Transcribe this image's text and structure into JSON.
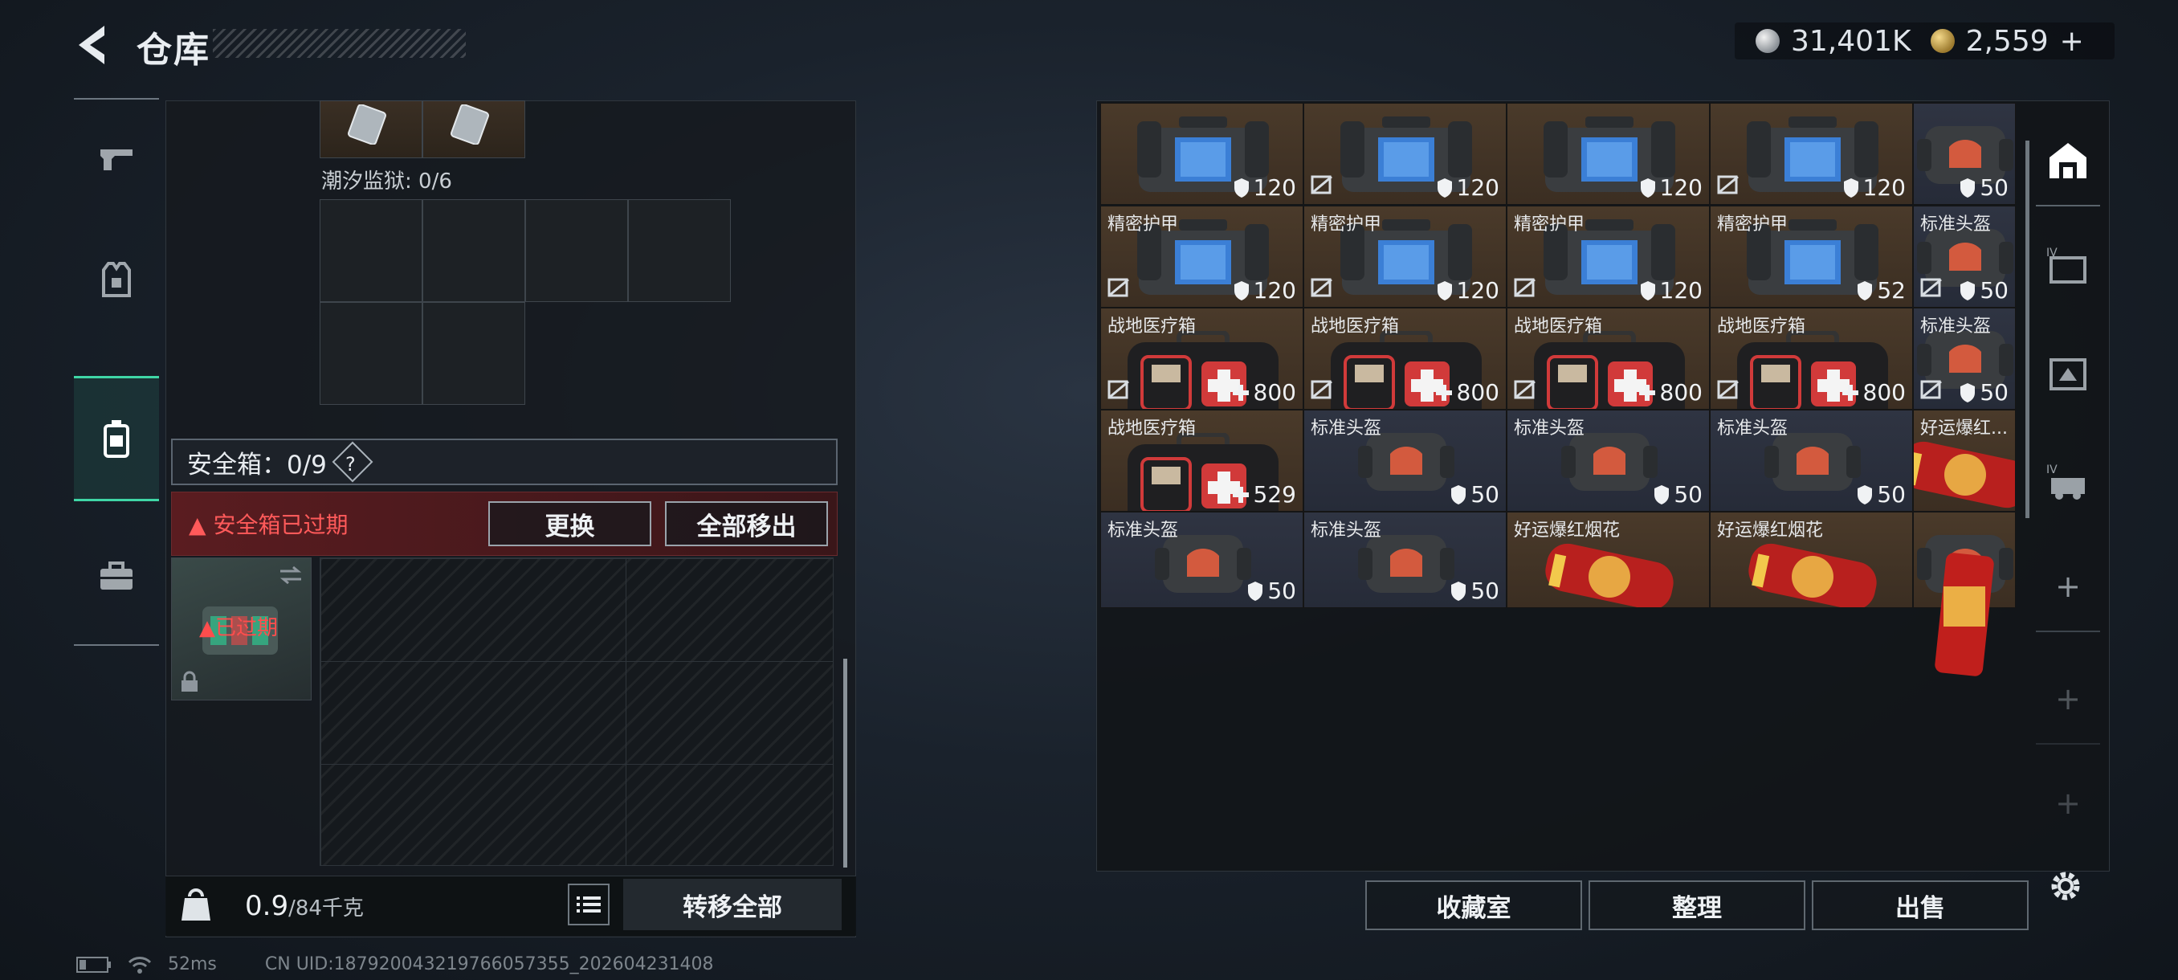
{
  "header": {
    "title": "仓库",
    "silver": "31,401K",
    "gold": "2,559",
    "gold_add": "+"
  },
  "left": {
    "prison_label": "潮汐监狱: 0/6",
    "safe_label": "安全箱：0/9",
    "help": "?",
    "expired_text": "安全箱已过期",
    "replace_btn": "更换",
    "remove_all_btn": "全部移出",
    "case_status": "已过期",
    "weight_value": "0.9",
    "weight_capacity": "/84千克",
    "transfer_all": "转移全部"
  },
  "right": {
    "rows": [
      [
        {
          "name": "",
          "value": "120",
          "type": "shield",
          "bg": "brown"
        },
        {
          "name": "",
          "value": "120",
          "type": "shield",
          "bg": "brown",
          "nr": true
        },
        {
          "name": "",
          "value": "120",
          "type": "shield",
          "bg": "brown"
        },
        {
          "name": "",
          "value": "120",
          "type": "shield",
          "bg": "brown",
          "nr": true
        },
        {
          "name": "",
          "value": "50",
          "type": "shield",
          "bg": "blue"
        }
      ],
      [
        {
          "name": "精密护甲",
          "value": "120",
          "type": "shield",
          "bg": "brown",
          "nr": true
        },
        {
          "name": "精密护甲",
          "value": "120",
          "type": "shield",
          "bg": "brown",
          "nr": true
        },
        {
          "name": "精密护甲",
          "value": "120",
          "type": "shield",
          "bg": "brown",
          "nr": true
        },
        {
          "name": "精密护甲",
          "value": "52",
          "type": "shield",
          "bg": "brown"
        },
        {
          "name": "标准头盔",
          "value": "50",
          "type": "shield",
          "bg": "blue",
          "nr": true
        }
      ],
      [
        {
          "name": "战地医疗箱",
          "value": "800",
          "type": "plus",
          "bg": "brown",
          "nr": true
        },
        {
          "name": "战地医疗箱",
          "value": "800",
          "type": "plus",
          "bg": "brown",
          "nr": true
        },
        {
          "name": "战地医疗箱",
          "value": "800",
          "type": "plus",
          "bg": "brown",
          "nr": true
        },
        {
          "name": "战地医疗箱",
          "value": "800",
          "type": "plus",
          "bg": "brown",
          "nr": true
        },
        {
          "name": "标准头盔",
          "value": "50",
          "type": "shield",
          "bg": "blue",
          "nr": true
        }
      ],
      [
        {
          "name": "战地医疗箱",
          "value": "529",
          "type": "plus",
          "bg": "brown"
        },
        {
          "name": "标准头盔",
          "value": "50",
          "type": "shield",
          "bg": "blue"
        },
        {
          "name": "标准头盔",
          "value": "50",
          "type": "shield",
          "bg": "blue"
        },
        {
          "name": "标准头盔",
          "value": "50",
          "type": "shield",
          "bg": "blue"
        },
        {
          "name": "好运爆红...",
          "value": "",
          "type": "none",
          "bg": "brown"
        }
      ],
      [
        {
          "name": "标准头盔",
          "value": "50",
          "type": "shield",
          "bg": "blue"
        },
        {
          "name": "标准头盔",
          "value": "50",
          "type": "shield",
          "bg": "blue"
        },
        {
          "name": "好运爆红烟花",
          "value": "",
          "type": "none",
          "bg": "brown"
        },
        {
          "name": "好运爆红烟花",
          "value": "",
          "type": "none",
          "bg": "brown"
        },
        {
          "name": "",
          "value": "",
          "type": "none",
          "bg": "brown"
        }
      ]
    ],
    "btn_collection": "收藏室",
    "btn_sort": "整理",
    "btn_sell": "出售",
    "plus_1": "+",
    "plus_2": "+",
    "plus_3": "+"
  },
  "status": {
    "ping": "52ms",
    "uid": "CN UID:187920043219766057355_202604231408"
  },
  "colors": {
    "accent": "#3fd6a6",
    "warning": "#ff5a5a",
    "brown_slot": "#3b2e22",
    "blue_slot": "#262b38"
  }
}
